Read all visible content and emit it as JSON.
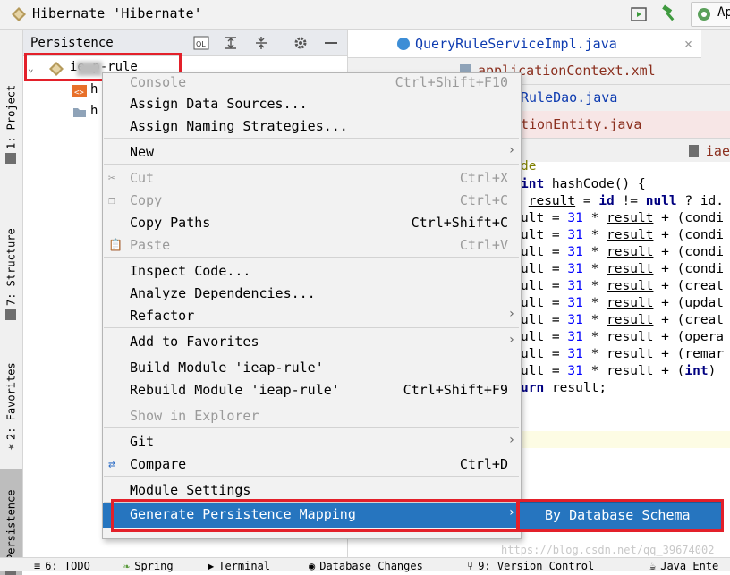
{
  "window": {
    "title": "Hibernate 'Hibernate'",
    "app_button": "Ap"
  },
  "left_strip": {
    "tabs": [
      "1: Project",
      "7: Structure",
      "2: Favorites",
      "Persistence"
    ]
  },
  "persistence_panel": {
    "title": "Persistence",
    "root_item": "ie  p-rule",
    "children": [
      "h",
      "h"
    ]
  },
  "editor_tabs": [
    {
      "label": "QueryRuleServiceImpl.java"
    },
    {
      "label": "applicationContext.xml"
    },
    {
      "label": "RuleDao.java"
    },
    {
      "label": "tionEntity.java"
    },
    {
      "label": "iae"
    }
  ],
  "editor": {
    "lines": [
      {
        "text": "de",
        "kind": "ann"
      },
      {
        "text": "int hashCode() {"
      },
      {
        "text": " result = id != null ? id."
      },
      {
        "text": "ult = 31 * result + (condi"
      },
      {
        "text": "ult = 31 * result + (condi"
      },
      {
        "text": "ult = 31 * result + (condi"
      },
      {
        "text": "ult = 31 * result + (condi"
      },
      {
        "text": "ult = 31 * result + (creat"
      },
      {
        "text": "ult = 31 * result + (updat"
      },
      {
        "text": "ult = 31 * result + (creat"
      },
      {
        "text": "ult = 31 * result + (opera"
      },
      {
        "text": "ult = 31 * result + (remar"
      },
      {
        "text": "ult = 31 * result + (int) "
      },
      {
        "text": "urn result;"
      }
    ],
    "watermark": "https://blog.csdn.net/qq_39674002"
  },
  "context_menu": {
    "items": [
      {
        "label": "Console",
        "shortcut": "Ctrl+Shift+F10",
        "disabled": true
      },
      {
        "label": "Assign Data Sources..."
      },
      {
        "label": "Assign Naming Strategies..."
      },
      {
        "label": "New",
        "submenu": true
      },
      {
        "label": "Cut",
        "shortcut": "Ctrl+X",
        "disabled": true
      },
      {
        "label": "Copy",
        "shortcut": "Ctrl+C",
        "disabled": true
      },
      {
        "label": "Copy Paths",
        "shortcut": "Ctrl+Shift+C"
      },
      {
        "label": "Paste",
        "shortcut": "Ctrl+V",
        "disabled": true
      },
      {
        "label": "Inspect Code..."
      },
      {
        "label": "Analyze Dependencies..."
      },
      {
        "label": "Refactor",
        "submenu": true
      },
      {
        "label": "Add to Favorites",
        "submenu": true
      },
      {
        "label": "Build Module 'ieap-rule'"
      },
      {
        "label": "Rebuild Module 'ieap-rule'",
        "shortcut": "Ctrl+Shift+F9"
      },
      {
        "label": "Show in Explorer",
        "disabled": true
      },
      {
        "label": "Git",
        "submenu": true
      },
      {
        "label": "Compare",
        "shortcut": "Ctrl+D"
      },
      {
        "label": "Module Settings"
      },
      {
        "label": "Generate Persistence Mapping",
        "submenu": true,
        "selected": true
      }
    ]
  },
  "submenu": {
    "items": [
      "By Database Schema"
    ]
  },
  "bottom_bar": {
    "items": [
      "6: TODO",
      "Spring",
      "Terminal",
      "Database Changes",
      "9: Version Control",
      "Java Ente"
    ]
  },
  "colors": {
    "selection": "#2675bf",
    "highlight_box": "#e3202a",
    "keyword": "#000080",
    "number": "#0000ff",
    "tab_text": "#0d3bb0"
  }
}
